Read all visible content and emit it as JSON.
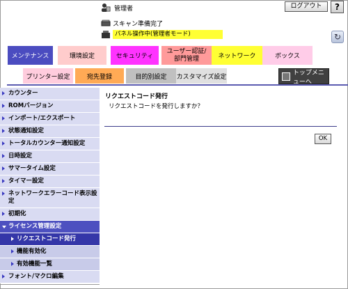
{
  "header": {
    "user_label": "管理者",
    "logout_label": "ログアウト",
    "help_label": "?",
    "scan_status": "スキャン準備完了",
    "panel_status": "パネル操作中(管理者モード)"
  },
  "tabs": [
    {
      "label": "メンテナンス",
      "color": "#4b4cc0",
      "text_color": "#ffffff"
    },
    {
      "label": "環境設定",
      "color": "#ffcccc",
      "text_color": "#000000"
    },
    {
      "label": "セキュリティ",
      "color": "#ff33ff",
      "text_color": "#000000"
    },
    {
      "label": "ユーザー認証/部門管理",
      "color": "#ff9a9a",
      "text_color": "#000000"
    },
    {
      "label": "ネットワーク",
      "color": "#ffff33",
      "text_color": "#000000"
    },
    {
      "label": "ボックス",
      "color": "#ffcce8",
      "text_color": "#000000"
    }
  ],
  "sub_tabs": [
    {
      "label": "プリンター設定",
      "color": "#ffccdd"
    },
    {
      "label": "宛先登録",
      "color": "#ffaa55"
    },
    {
      "label": "目的別設定",
      "color": "#c0c0c0"
    },
    {
      "label": "カスタマイズ設定",
      "color": "#e0e0e0"
    }
  ],
  "top_menu_label": "トップメニューへ",
  "sidebar": {
    "items": [
      {
        "label": "カウンター"
      },
      {
        "label": "ROMバージョン"
      },
      {
        "label": "インポート/エクスポート"
      },
      {
        "label": "状態通知設定"
      },
      {
        "label": "トータルカウンター通知設定"
      },
      {
        "label": "日時設定"
      },
      {
        "label": "サマータイム設定"
      },
      {
        "label": "タイマー設定"
      },
      {
        "label": "ネットワークエラーコード表示設定"
      },
      {
        "label": "初期化"
      },
      {
        "label": "ライセンス管理設定"
      },
      {
        "label": "リクエストコード発行"
      },
      {
        "label": "機能有効化"
      },
      {
        "label": "有効機能一覧"
      },
      {
        "label": "フォント/マクロ編集"
      }
    ]
  },
  "main": {
    "title": "リクエストコード発行",
    "description": "リクエストコードを発行しますか？",
    "ok_label": "OK"
  },
  "colors": {
    "accent": "#4b4cc0",
    "sidebar_bg": "#d9dbf2",
    "sidebar_active": "#3436a8",
    "panel_status_bg": "#ffff33"
  }
}
